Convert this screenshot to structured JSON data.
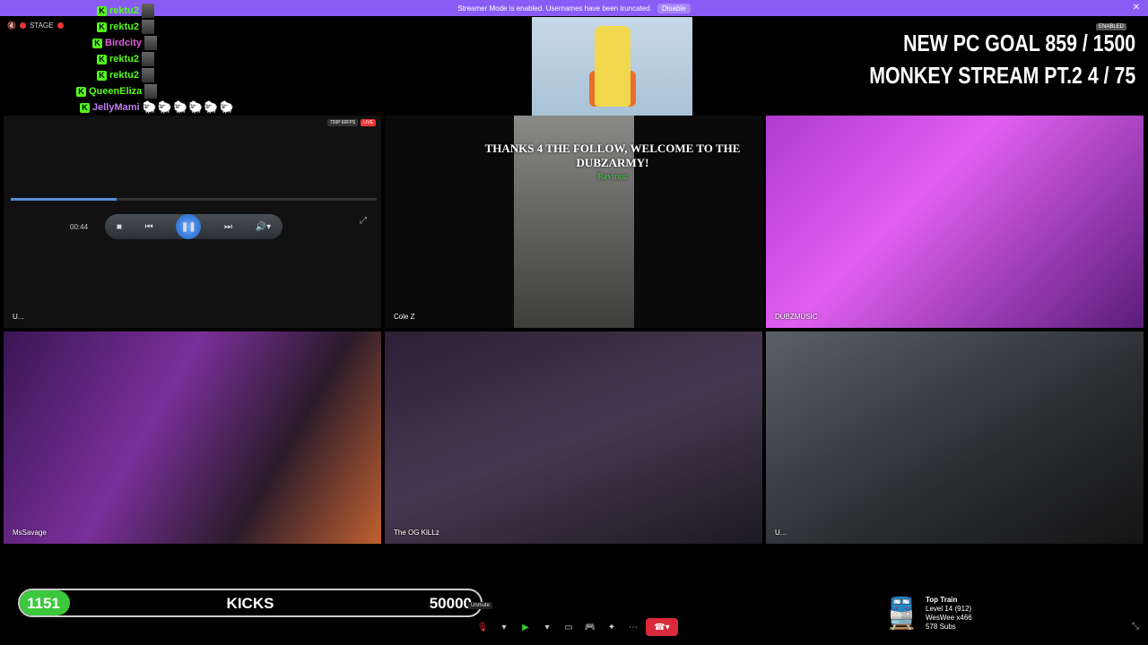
{
  "banner": {
    "text": "Streamer Mode is enabled. Usernames have been truncated.",
    "button": "Disable"
  },
  "stage": {
    "label": "STAGE"
  },
  "chat": {
    "lines": [
      {
        "user": "rektu2",
        "color": "#53fc18",
        "emotes": ""
      },
      {
        "user": "rektu2",
        "color": "#53fc18",
        "emotes": ""
      },
      {
        "user": "Birdcity",
        "color": "#e060e0",
        "emotes": ""
      },
      {
        "user": "rektu2",
        "color": "#53fc18",
        "emotes": ""
      },
      {
        "user": "rektu2",
        "color": "#53fc18",
        "emotes": ""
      },
      {
        "user": "QueenEliza",
        "color": "#53fc18",
        "emotes": ""
      },
      {
        "user": "JellyMami",
        "color": "#c07cf0",
        "emotes": "🐑🐑🐑🐑🐑🐑"
      }
    ]
  },
  "goals": {
    "enabled_badge": "ENABLED",
    "line1": "NEW PC GOAL  859 / 1500",
    "line2": "MONKEY STREAM PT.2  4 / 75"
  },
  "player": {
    "quality": "720P 60FPS",
    "live": "LIVE",
    "time": "00:44",
    "progress": 0.29
  },
  "follow_alert": {
    "message": "THANKS 4 THE FOLLOW, WELCOME TO THE DUBZARMY!",
    "user": "Revinoz"
  },
  "tiles": [
    {
      "label": "U..."
    },
    {
      "label": "Cole Z"
    },
    {
      "label": "DUBZMUSIC"
    },
    {
      "label": "MsSavage"
    },
    {
      "label": "The OG KiLLz"
    },
    {
      "label": "U..."
    }
  ],
  "kicks_goal": {
    "current": "1151",
    "label": "KICKS",
    "goal": "50000",
    "progress": 0.023
  },
  "toolbar": {
    "tooltip": "Unmute"
  },
  "top_train": {
    "title": "Top Train",
    "level": "Level 14 (912)",
    "leader": "WesWee x466",
    "subs": "578 Subs"
  },
  "colors": {
    "banner": "#8a5cf6",
    "kick_green": "#53fc18",
    "hangup": "#d9293a"
  }
}
